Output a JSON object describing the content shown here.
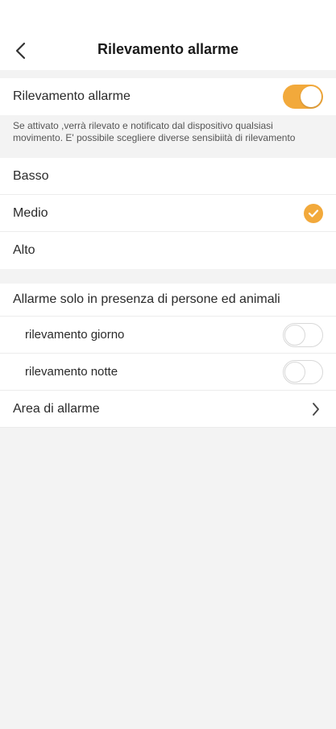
{
  "header": {
    "title": "Rilevamento allarme",
    "back_icon": "chevron-left-icon"
  },
  "detection": {
    "label": "Rilevamento allarme",
    "enabled": true
  },
  "description": "Se attivato ,verrà rilevato e notificato dal dispositivo qualsiasi movimento. E' possibile scegliere diverse sensibiità di rilevamento",
  "sensitivity": {
    "options": [
      "Basso",
      "Medio",
      "Alto"
    ],
    "selected": "Medio"
  },
  "people_animals": {
    "label": "Allarme solo in presenza di persone ed animali",
    "day_label": "rilevamento giorno",
    "day_enabled": false,
    "night_label": "rilevamento notte",
    "night_enabled": false
  },
  "alarm_area": {
    "label": "Area di allarme"
  },
  "colors": {
    "accent": "#f2a93b",
    "background": "#f3f3f3"
  }
}
